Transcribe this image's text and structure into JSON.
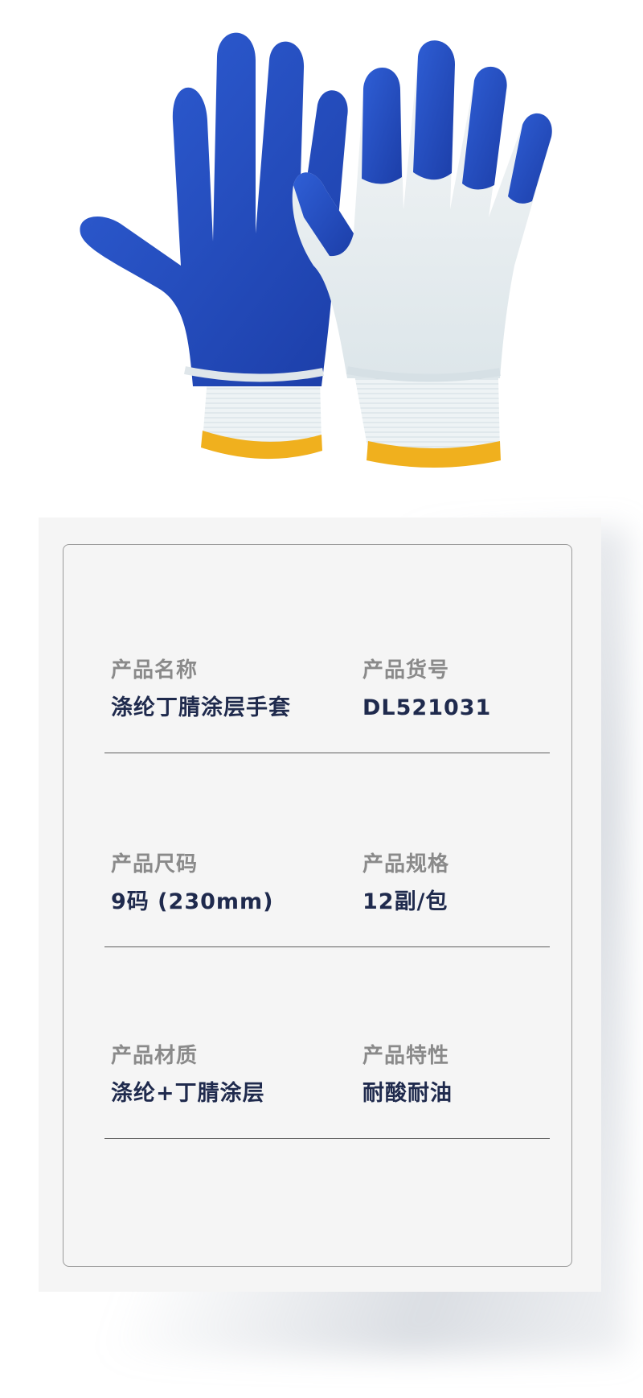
{
  "specs": [
    {
      "left": {
        "label": "产品名称",
        "value": "涤纶丁腈涂层手套"
      },
      "right": {
        "label": "产品货号",
        "value": "DL521031"
      }
    },
    {
      "left": {
        "label": "产品尺码",
        "value": "9码 (230mm)"
      },
      "right": {
        "label": "产品规格",
        "value": "12副/包"
      }
    },
    {
      "left": {
        "label": "产品材质",
        "value": "涤纶+丁腈涂层"
      },
      "right": {
        "label": "产品特性",
        "value": "耐酸耐油"
      }
    }
  ],
  "colors": {
    "glove_coating": "#2245b8",
    "glove_knit": "#eef1f3",
    "cuff_trim": "#f0b01e",
    "label": "#8a8a8a",
    "value": "#1f2a4d"
  }
}
